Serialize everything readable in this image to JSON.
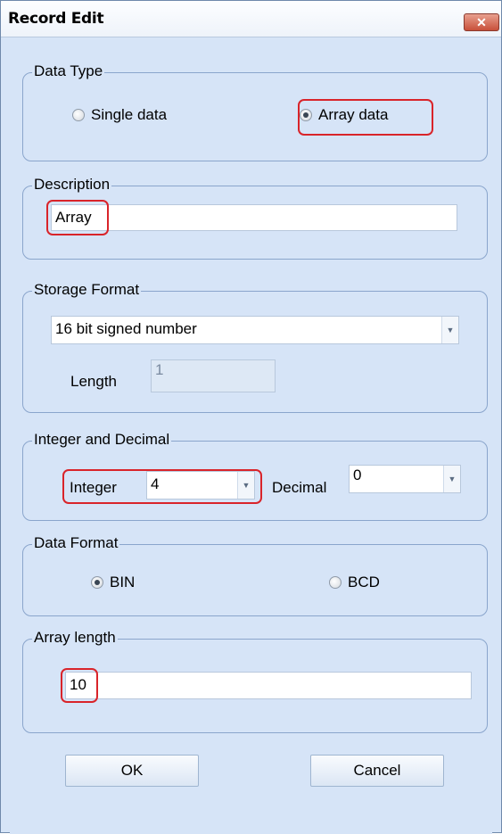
{
  "window": {
    "title": "Record Edit",
    "close_glyph": "✕"
  },
  "data_type": {
    "legend": "Data Type",
    "single": "Single data",
    "array": "Array data",
    "selected": "array"
  },
  "description": {
    "legend": "Description",
    "value": "Array"
  },
  "storage_format": {
    "legend": "Storage Format",
    "value": "16 bit signed number",
    "length_label": "Length",
    "length_value": "1"
  },
  "integer_decimal": {
    "legend": "Integer and Decimal",
    "integer_label": "Integer",
    "integer_value": "4",
    "decimal_label": "Decimal",
    "decimal_value": "0"
  },
  "data_format": {
    "legend": "Data Format",
    "bin": "BIN",
    "bcd": "BCD",
    "selected": "BIN"
  },
  "array_length": {
    "legend": "Array length",
    "value": "10"
  },
  "buttons": {
    "ok": "OK",
    "cancel": "Cancel"
  },
  "icons": {
    "combo_arrow": "chevron-down-icon"
  },
  "colors": {
    "highlight": "#d9242a",
    "panel": "#d6e4f7",
    "close": "#c8503a"
  }
}
